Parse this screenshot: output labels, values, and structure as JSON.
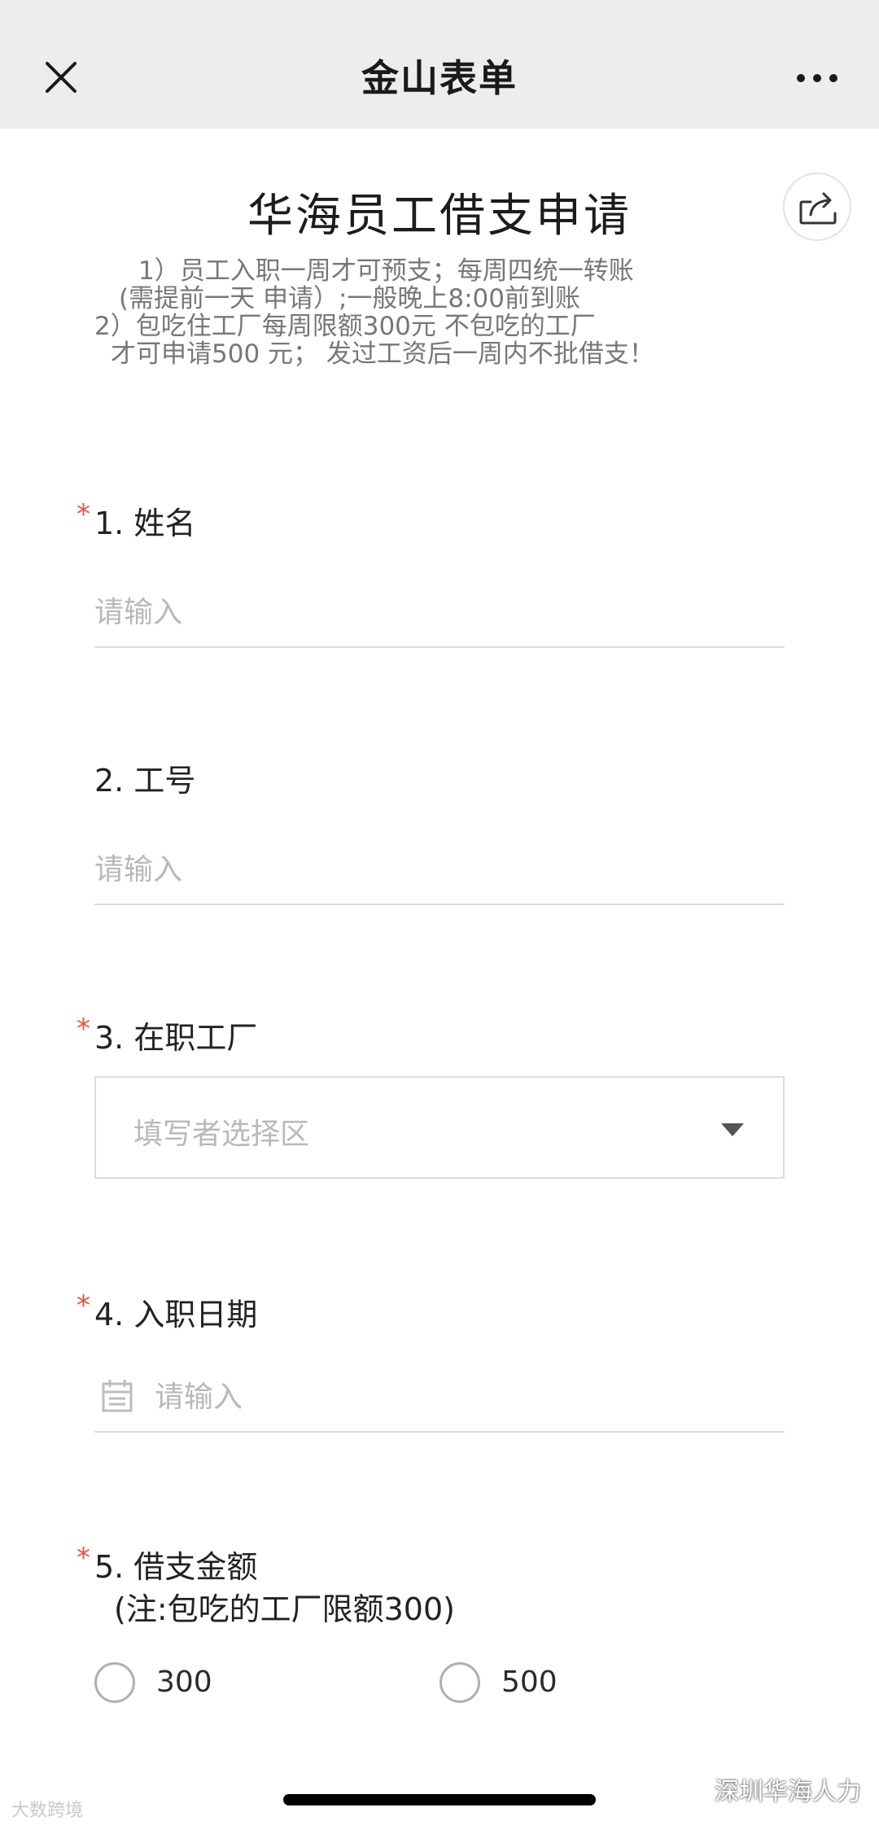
{
  "nav": {
    "title": "金山表单"
  },
  "form": {
    "title": "华海员工借支申请",
    "notice_lines": [
      "1）员工入职一周才可预支；每周四统一转账",
      "(需提前一天 申请）;一般晚上8:00前到账",
      "2）包吃住工厂每周限额300元 不包吃的工厂",
      "才可申请500 元；  发过工资后一周内不批借支！"
    ]
  },
  "questions": {
    "q1": {
      "required": "*",
      "label": "1.  姓名",
      "placeholder": "请输入"
    },
    "q2": {
      "label": "2.  工号",
      "placeholder": "请输入"
    },
    "q3": {
      "required": "*",
      "label": "3.  在职工厂",
      "select_placeholder": "填写者选择区"
    },
    "q4": {
      "required": "*",
      "label": "4.  入职日期",
      "placeholder": "请输入"
    },
    "q5": {
      "required": "*",
      "label": "5.  借支金额",
      "sublabel": "(注:包吃的工厂限额300)",
      "options": [
        "300",
        "500"
      ]
    }
  },
  "watermarks": {
    "left": "大数跨境",
    "right": "深圳华海人力"
  },
  "icons": {
    "close": "close-icon",
    "more": "more-icon",
    "share": "share-icon",
    "caret": "caret-down-icon",
    "calendar": "calendar-icon",
    "wechat": "wechat-icon"
  },
  "colors": {
    "required": "#e5553d",
    "navbar_bg": "#ededed",
    "placeholder": "#b9b9b9"
  }
}
